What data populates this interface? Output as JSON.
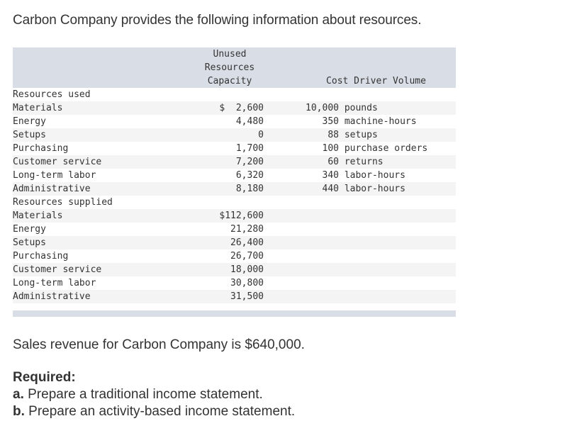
{
  "intro": "Carbon Company provides the following information about resources.",
  "table": {
    "headers": {
      "capacity_line1": "Unused",
      "capacity_line2": "Resources",
      "capacity_line3": "Capacity",
      "driver": "Cost Driver Volume"
    },
    "sections": [
      {
        "title": "Resources used",
        "rows": [
          {
            "label": "Materials",
            "value": "$  2,600",
            "driver_qty": "10,000",
            "driver_unit": "pounds"
          },
          {
            "label": "Energy",
            "value": "4,480",
            "driver_qty": "350",
            "driver_unit": "machine-hours"
          },
          {
            "label": "Setups",
            "value": "0",
            "driver_qty": "88",
            "driver_unit": "setups"
          },
          {
            "label": "Purchasing",
            "value": "1,700",
            "driver_qty": "100",
            "driver_unit": "purchase orders"
          },
          {
            "label": "Customer service",
            "value": "7,200",
            "driver_qty": "60",
            "driver_unit": "returns"
          },
          {
            "label": "Long-term labor",
            "value": "6,320",
            "driver_qty": "340",
            "driver_unit": "labor-hours"
          },
          {
            "label": "Administrative",
            "value": "8,180",
            "driver_qty": "440",
            "driver_unit": "labor-hours"
          }
        ]
      },
      {
        "title": "Resources supplied",
        "rows": [
          {
            "label": "Materials",
            "value": "$112,600"
          },
          {
            "label": "Energy",
            "value": "21,280"
          },
          {
            "label": "Setups",
            "value": "26,400"
          },
          {
            "label": "Purchasing",
            "value": "26,700"
          },
          {
            "label": "Customer service",
            "value": "18,000"
          },
          {
            "label": "Long-term labor",
            "value": "30,800"
          },
          {
            "label": "Administrative",
            "value": "31,500"
          }
        ]
      }
    ]
  },
  "sales_text": "Sales revenue for Carbon Company is $640,000.",
  "required": {
    "title": "Required:",
    "items": [
      {
        "marker": "a.",
        "text": " Prepare a traditional income statement."
      },
      {
        "marker": "b.",
        "text": " Prepare an activity-based income statement."
      }
    ]
  }
}
